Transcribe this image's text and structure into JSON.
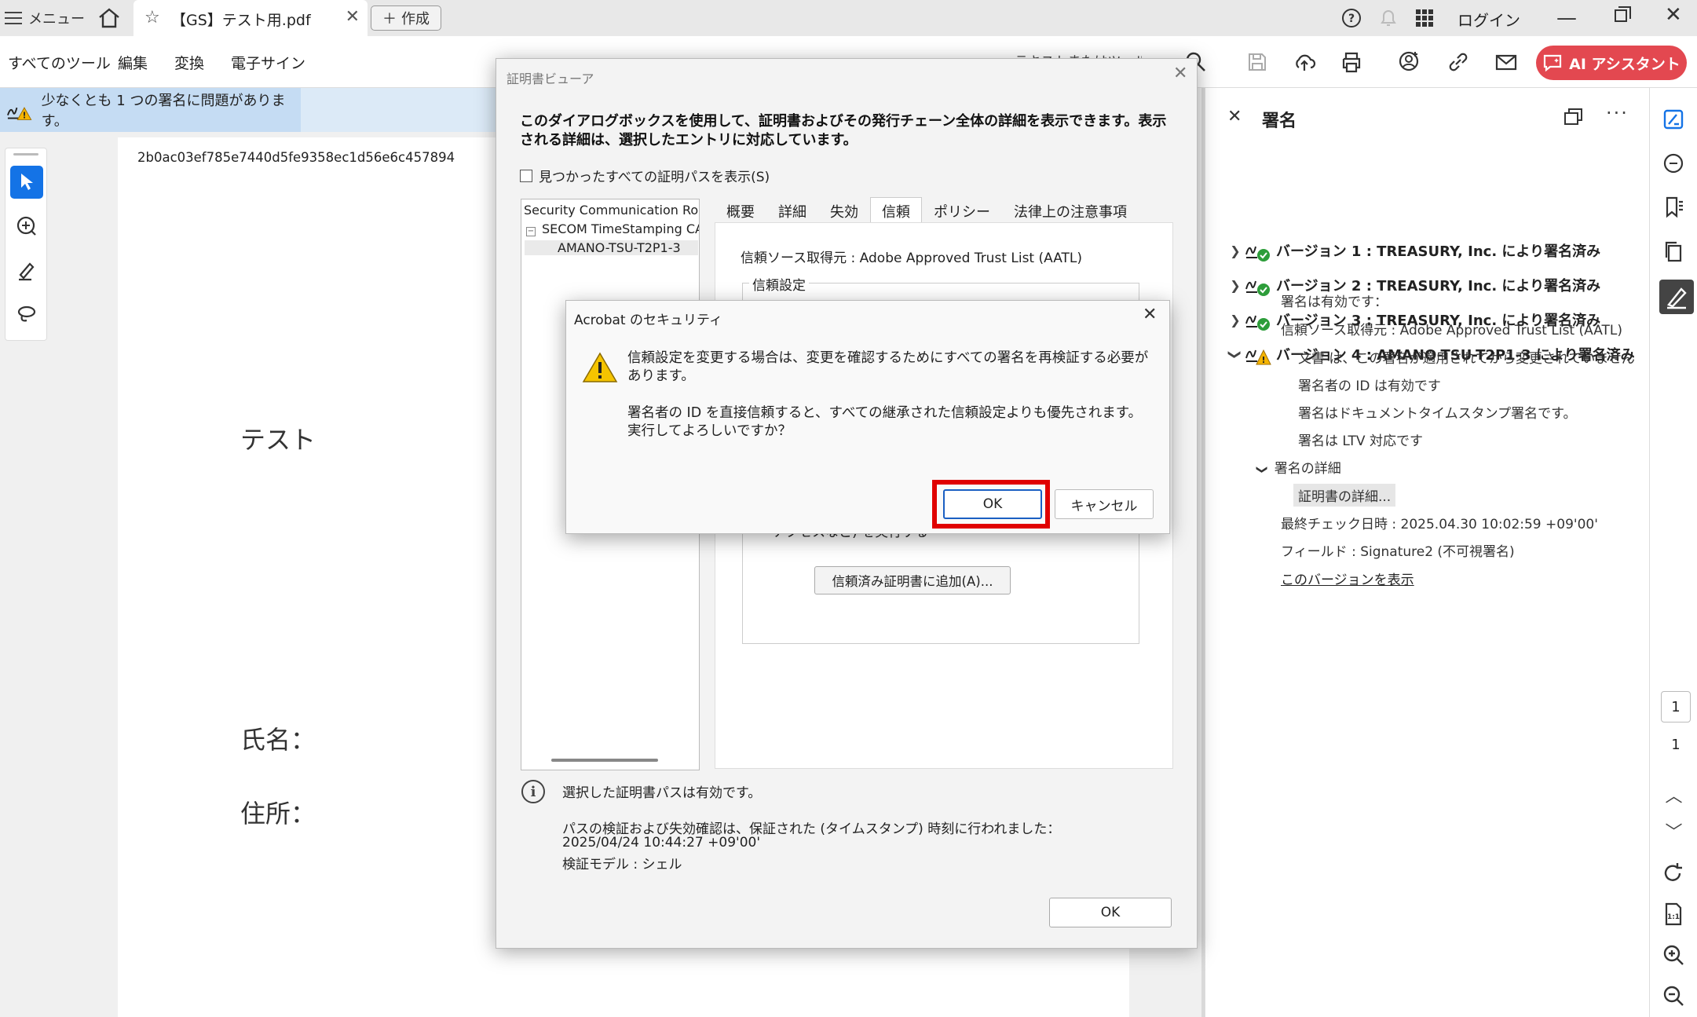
{
  "titlebar": {
    "menu_label": "メニュー",
    "tab_title": "【GS】テスト用.pdf",
    "new_tab_label": "作成",
    "login_label": "ログイン"
  },
  "toolbar": {
    "tabs": [
      "すべてのツール",
      "編集",
      "変換",
      "電子サイン"
    ],
    "search_hint": "テキストまたはツールを検索",
    "ai_label": "AI アシスタント",
    "accent_color": "#1473e6",
    "ai_color": "#e34850"
  },
  "document": {
    "warning": "少なくとも 1 つの署名に問題があります。",
    "hash": "2b0ac03ef785e7440d5fe9358ec1d56e6c457894",
    "test_label": "テスト",
    "name_label": "氏名：",
    "address_label": "住所："
  },
  "signature_panel": {
    "title": "署名",
    "versions": [
      "バージョン 1 : TREASURY, Inc. により署名済み",
      "バージョン 2 : TREASURY, Inc. により署名済み",
      "バージョン 3 : TREASURY, Inc. により署名済み",
      "バージョン 4 : AMANO-TSU-T2P1-3 により署名済み"
    ],
    "valid": "署名は有効です：",
    "trust_source": "信頼ソース取得元 : Adobe Approved Trust List (AATL)",
    "not_modified": "文書 は、この署名が適用されてから変更されていません",
    "signer_id_valid": "署名者の ID は有効です",
    "timestamp_sig": "署名はドキュメントタイムスタンプ署名です。",
    "ltv": "署名は LTV 対応です",
    "details_header": "署名の詳細",
    "cert_details": "証明書の詳細...",
    "last_checked": "最終チェック日時 : 2025.04.30 10:02:59 +09'00'",
    "field": "フィールド : Signature2 (不可視署名)",
    "show_version": "このバージョンを表示"
  },
  "rail": {
    "page_current": "1",
    "page_total": "1"
  },
  "cert_viewer": {
    "title": "証明書ビューア",
    "description": "このダイアログボックスを使用して、証明書およびその発行チェーン全体の詳細を表示できます。表示される詳細は、選択したエントリに対応しています。",
    "show_all_paths": "見つかったすべての証明パスを表示(S)",
    "tree": [
      "Security Communication RootCA",
      "SECOM TimeStamping CA",
      "AMANO-TSU-T2P1-3"
    ],
    "tabs": [
      "概要",
      "詳細",
      "失効",
      "信頼",
      "ポリシー",
      "法律上の注意事項"
    ],
    "trust_source": "信頼ソース取得元 : Adobe Approved Trust List (AATL)",
    "trust_settings_label": "信頼設定",
    "access_line": "アクセスなど) を実行する",
    "add_trusted_btn": "信頼済み証明書に追加(A)...",
    "path_valid": "選択した証明書パスは有効です。",
    "path_check_line": "パスの検証および失効確認は、保証された (タイムスタンプ) 時刻に行われました：",
    "path_check_time": "2025/04/24 10:44:27 +09'00'",
    "validation_model": "検証モデル : シェル",
    "ok_label": "OK"
  },
  "security_dialog": {
    "title": "Acrobat のセキュリティ",
    "message1": "信頼設定を変更する場合は、変更を確認するためにすべての署名を再検証する必要があります。",
    "message2": "署名者の ID を直接信頼すると、すべての継承された信頼設定よりも優先されます。実行してよろしいですか？",
    "ok_label": "OK",
    "cancel_label": "キャンセル",
    "highlight_color": "#e00000"
  }
}
